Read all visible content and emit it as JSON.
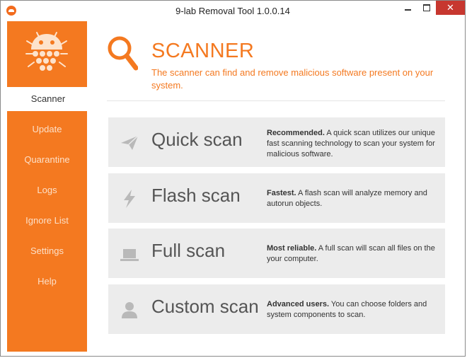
{
  "window": {
    "title": "9-lab Removal Tool 1.0.0.14",
    "close_glyph": "✕"
  },
  "sidebar": {
    "items": [
      {
        "label": "Scanner",
        "active": true
      },
      {
        "label": "Update"
      },
      {
        "label": "Quarantine"
      },
      {
        "label": "Logs"
      },
      {
        "label": "Ignore List"
      },
      {
        "label": "Settings"
      },
      {
        "label": "Help"
      }
    ]
  },
  "header": {
    "title": "SCANNER",
    "description": "The scanner can find and remove malicious software present on your system.",
    "icon": "magnifier-icon"
  },
  "scans": [
    {
      "name": "Quick scan",
      "icon": "paper-plane-icon",
      "desc_bold": "Recommended.",
      "desc_text": " A quick scan utilizes our unique fast scanning technology to scan your system for malicious software."
    },
    {
      "name": "Flash scan",
      "icon": "lightning-icon",
      "desc_bold": "Fastest.",
      "desc_text": " A flash scan will analyze memory and autorun objects."
    },
    {
      "name": "Full scan",
      "icon": "laptop-icon",
      "desc_bold": "Most reliable.",
      "desc_text": " A full scan will scan all files on the your computer."
    },
    {
      "name": "Custom scan",
      "icon": "user-icon",
      "desc_bold": "Advanced users.",
      "desc_text": " You can choose folders and system components to scan."
    }
  ],
  "colors": {
    "accent": "#f47920",
    "card": "#ececec",
    "close": "#c7372f"
  }
}
